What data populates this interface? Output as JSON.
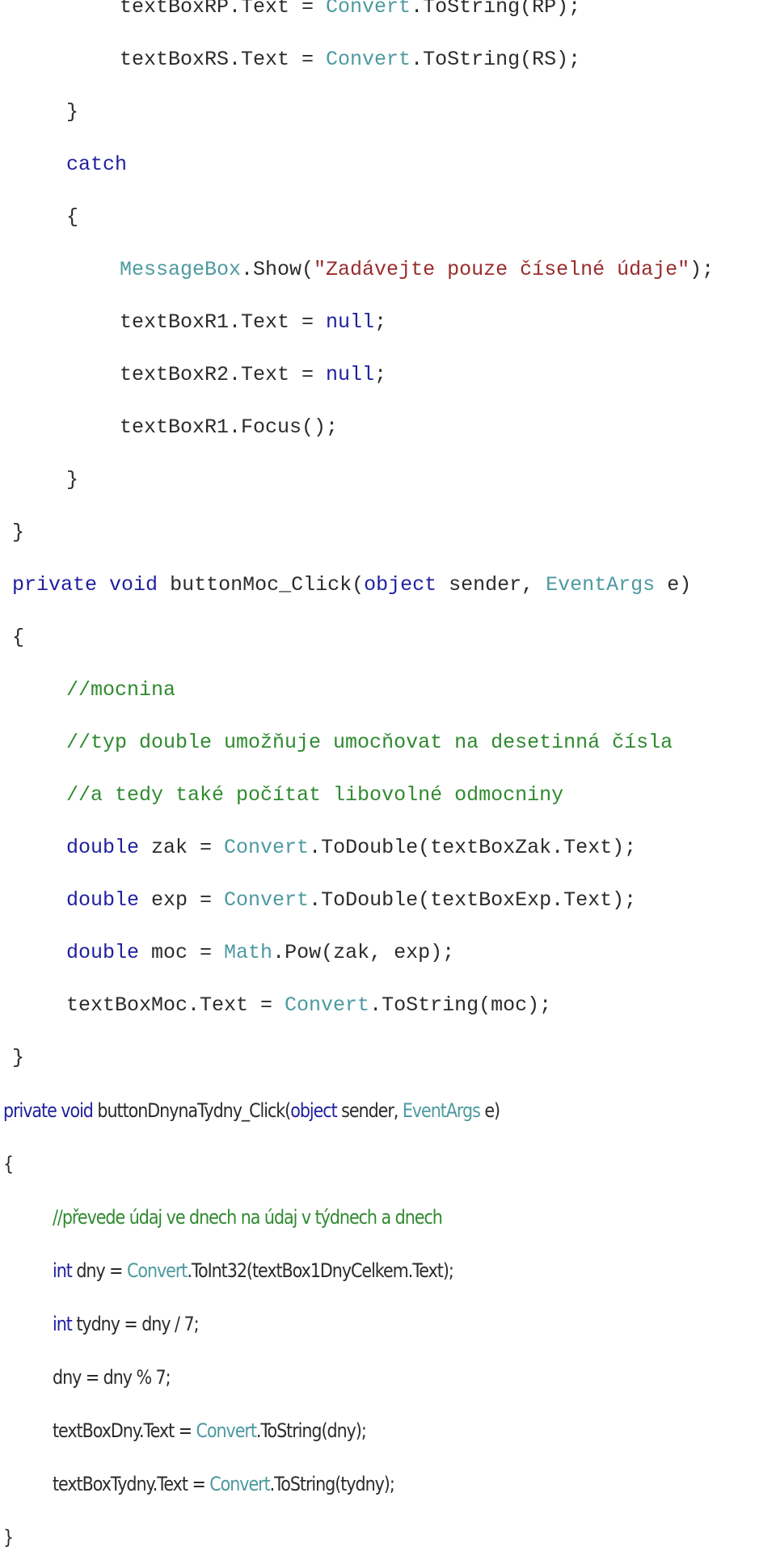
{
  "document": {
    "colors": {
      "keyword": "#1f1f9e",
      "type": "#4c9aa0",
      "string": "#9a2b2b",
      "comment": "#2f8a2f",
      "plain": "#2b2b2b"
    },
    "lines": [
      {
        "tokens": [
          {
            "t": "textBoxRP.Text = ",
            "c": "pl"
          },
          {
            "t": "Convert",
            "c": "ty"
          },
          {
            "t": ".ToString(RP);",
            "c": "pl"
          }
        ]
      },
      {
        "tokens": [
          {
            "t": "textBoxRS.Text = ",
            "c": "pl"
          },
          {
            "t": "Convert",
            "c": "ty"
          },
          {
            "t": ".ToString(RS);",
            "c": "pl"
          }
        ]
      },
      {
        "tokens": [
          {
            "t": "}",
            "c": "pl"
          }
        ]
      },
      {
        "tokens": [
          {
            "t": "catch",
            "c": "kw"
          }
        ]
      },
      {
        "tokens": [
          {
            "t": "{",
            "c": "pl"
          }
        ]
      },
      {
        "tokens": [
          {
            "t": "MessageBox",
            "c": "ty"
          },
          {
            "t": ".Show(",
            "c": "pl"
          },
          {
            "t": "\"Zadávejte pouze číselné údaje\"",
            "c": "str"
          },
          {
            "t": ");",
            "c": "pl"
          }
        ]
      },
      {
        "tokens": [
          {
            "t": "textBoxR1.Text = ",
            "c": "pl"
          },
          {
            "t": "null",
            "c": "kw"
          },
          {
            "t": ";",
            "c": "pl"
          }
        ]
      },
      {
        "tokens": [
          {
            "t": "textBoxR2.Text = ",
            "c": "pl"
          },
          {
            "t": "null",
            "c": "kw"
          },
          {
            "t": ";",
            "c": "pl"
          }
        ]
      },
      {
        "tokens": [
          {
            "t": "textBoxR1.Focus();",
            "c": "pl"
          }
        ]
      },
      {
        "tokens": [
          {
            "t": "}",
            "c": "pl"
          }
        ]
      },
      {
        "tokens": [
          {
            "t": "}",
            "c": "pl"
          }
        ]
      },
      {
        "tokens": [
          {
            "t": "private",
            "c": "kw"
          },
          {
            "t": " ",
            "c": "pl"
          },
          {
            "t": "void",
            "c": "kw"
          },
          {
            "t": " buttonMoc_Click(",
            "c": "pl"
          },
          {
            "t": "object",
            "c": "kw"
          },
          {
            "t": " sender, ",
            "c": "pl"
          },
          {
            "t": "EventArgs",
            "c": "ty"
          },
          {
            "t": " e)",
            "c": "pl"
          }
        ]
      },
      {
        "tokens": [
          {
            "t": "{",
            "c": "pl"
          }
        ]
      },
      {
        "tokens": [
          {
            "t": "//mocnina",
            "c": "cm"
          }
        ]
      },
      {
        "tokens": [
          {
            "t": "//typ double umožňuje umocňovat na desetinná čísla",
            "c": "cm"
          }
        ]
      },
      {
        "tokens": [
          {
            "t": "//a tedy také počítat libovolné odmocniny",
            "c": "cm"
          }
        ]
      },
      {
        "tokens": [
          {
            "t": "double",
            "c": "kw"
          },
          {
            "t": " zak = ",
            "c": "pl"
          },
          {
            "t": "Convert",
            "c": "ty"
          },
          {
            "t": ".ToDouble(textBoxZak.Text);",
            "c": "pl"
          }
        ]
      },
      {
        "tokens": [
          {
            "t": "double",
            "c": "kw"
          },
          {
            "t": " exp = ",
            "c": "pl"
          },
          {
            "t": "Convert",
            "c": "ty"
          },
          {
            "t": ".ToDouble(textBoxExp.Text);",
            "c": "pl"
          }
        ]
      },
      {
        "tokens": [
          {
            "t": "double",
            "c": "kw"
          },
          {
            "t": " moc = ",
            "c": "pl"
          },
          {
            "t": "Math",
            "c": "ty"
          },
          {
            "t": ".Pow(zak, exp);",
            "c": "pl"
          }
        ]
      },
      {
        "tokens": [
          {
            "t": "textBoxMoc.Text = ",
            "c": "pl"
          },
          {
            "t": "Convert",
            "c": "ty"
          },
          {
            "t": ".ToString(moc);",
            "c": "pl"
          }
        ]
      },
      {
        "tokens": [
          {
            "t": "}",
            "c": "pl"
          }
        ]
      },
      {
        "tokens": [
          {
            "t": "private",
            "c": "kw"
          },
          {
            "t": " ",
            "c": "pl"
          },
          {
            "t": "void",
            "c": "kw"
          },
          {
            "t": " buttonDnynaTydny_Click(",
            "c": "pl"
          },
          {
            "t": "object",
            "c": "kw"
          },
          {
            "t": " sender, ",
            "c": "pl"
          },
          {
            "t": "EventArgs",
            "c": "ty"
          },
          {
            "t": " e)",
            "c": "pl"
          }
        ]
      },
      {
        "tokens": [
          {
            "t": "{",
            "c": "pl"
          }
        ]
      },
      {
        "tokens": [
          {
            "t": "//převede údaj ve dnech na údaj v týdnech a dnech",
            "c": "cm"
          }
        ]
      },
      {
        "tokens": [
          {
            "t": "int",
            "c": "kw"
          },
          {
            "t": " dny = ",
            "c": "pl"
          },
          {
            "t": "Convert",
            "c": "ty"
          },
          {
            "t": ".ToInt32(textBox1DnyCelkem.Text);",
            "c": "pl"
          }
        ]
      },
      {
        "tokens": [
          {
            "t": "int",
            "c": "kw"
          },
          {
            "t": " tydny = dny / 7;",
            "c": "pl"
          }
        ]
      },
      {
        "tokens": [
          {
            "t": "dny = dny % 7;",
            "c": "pl"
          }
        ]
      },
      {
        "tokens": [
          {
            "t": "textBoxDny.Text = ",
            "c": "pl"
          },
          {
            "t": "Convert",
            "c": "ty"
          },
          {
            "t": ".ToString(dny);",
            "c": "pl"
          }
        ]
      },
      {
        "tokens": [
          {
            "t": "textBoxTydny.Text = ",
            "c": "pl"
          },
          {
            "t": "Convert",
            "c": "ty"
          },
          {
            "t": ".ToString(tydny);",
            "c": "pl"
          }
        ]
      },
      {
        "tokens": [
          {
            "t": "}",
            "c": "pl"
          }
        ]
      }
    ]
  }
}
